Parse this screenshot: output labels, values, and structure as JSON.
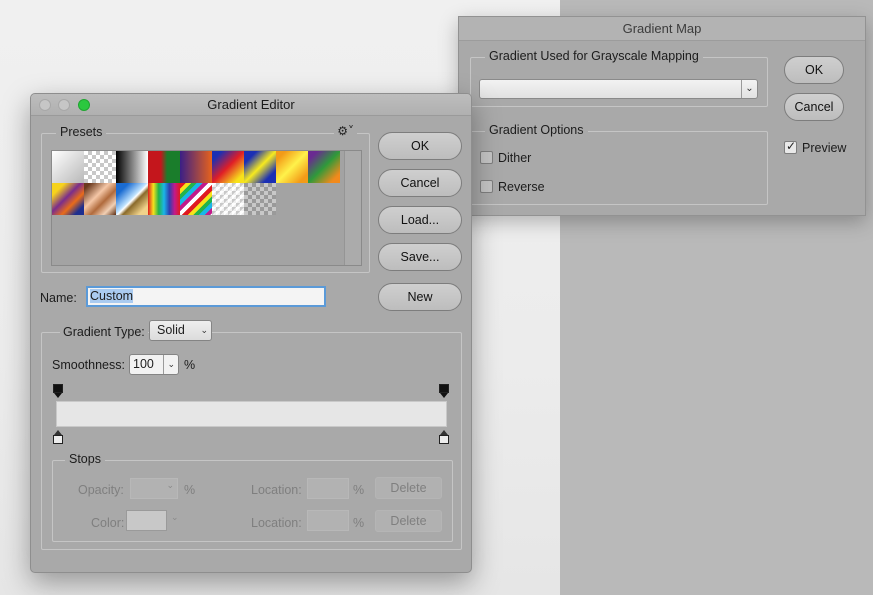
{
  "gradient_map": {
    "title": "Gradient Map",
    "group_mapping_label": "Gradient Used for Grayscale Mapping",
    "gradient_combo_value": "",
    "group_options_label": "Gradient Options",
    "dither_label": "Dither",
    "dither_checked": false,
    "reverse_label": "Reverse",
    "reverse_checked": false,
    "ok_label": "OK",
    "cancel_label": "Cancel",
    "preview_label": "Preview",
    "preview_checked": true
  },
  "gradient_editor": {
    "title": "Gradient Editor",
    "presets_label": "Presets",
    "gear_icon": "gear-icon",
    "ok_label": "OK",
    "cancel_label": "Cancel",
    "load_label": "Load...",
    "save_label": "Save...",
    "name_label": "Name:",
    "name_value": "Custom",
    "new_label": "New",
    "gradient_type_label": "Gradient Type:",
    "gradient_type_value": "Solid",
    "smoothness_label": "Smoothness:",
    "smoothness_value": "100",
    "smoothness_unit": "%",
    "stops": {
      "label": "Stops",
      "opacity_label": "Opacity:",
      "opacity_unit": "%",
      "opacity_location_label": "Location:",
      "opacity_location_unit": "%",
      "opacity_delete_label": "Delete",
      "color_label": "Color:",
      "color_location_label": "Location:",
      "color_location_unit": "%",
      "color_delete_label": "Delete"
    },
    "gradient_bar_colors": [
      "#e6e6e6",
      "#e6e6e6"
    ],
    "presets": [
      "white-to-gray",
      "white-to-transparent",
      "black-to-white",
      "red-green",
      "violet-orange",
      "blue-red-yellow",
      "blue-yellow-blue",
      "orange-yellow-orange",
      "violet-green-orange",
      "yellow-violet-orange-blue",
      "copper",
      "chrome",
      "spectrum",
      "transparent-rainbow",
      "transparent-stripes",
      "neutral-density"
    ]
  }
}
